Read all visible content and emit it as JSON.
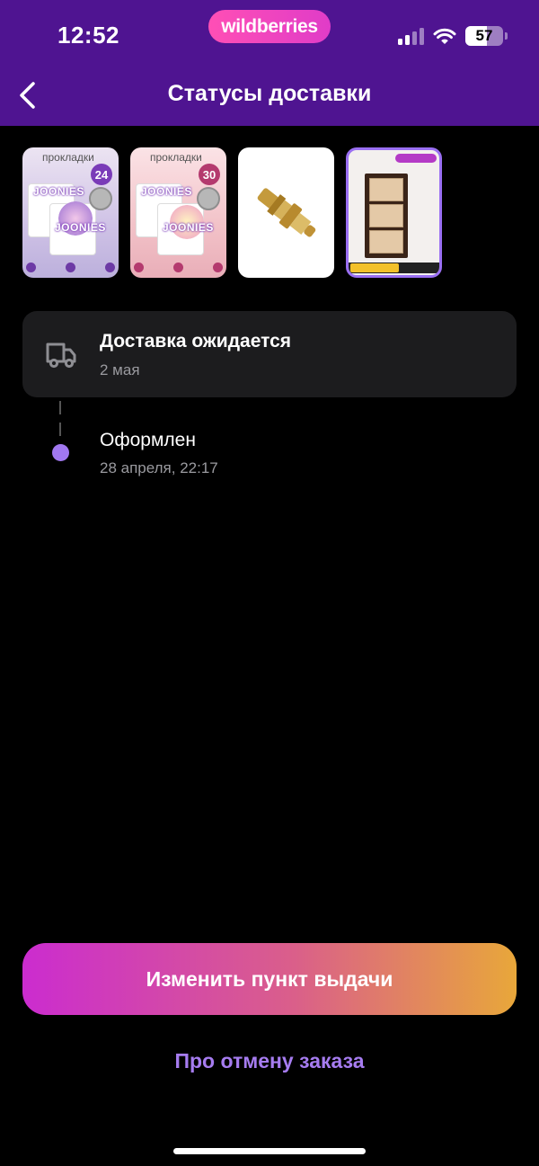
{
  "status_bar": {
    "time": "12:52",
    "brand": "wildberries",
    "battery": "57",
    "battery_level": 0.57,
    "icons": [
      "signal-icon",
      "wifi-icon",
      "battery-icon"
    ]
  },
  "header": {
    "title": "Статусы доставки",
    "back_icon": "chevron-left-icon"
  },
  "products": [
    {
      "label": "прокладки",
      "brand": "JOONIES",
      "count": "24"
    },
    {
      "label": "прокладки",
      "brand": "JOONIES",
      "count": "30"
    },
    {
      "label": ""
    },
    {
      "label": ""
    }
  ],
  "delivery": {
    "status": "Доставка ожидается",
    "date": "2 мая",
    "icon": "truck-icon"
  },
  "timeline": [
    {
      "title": "Оформлен",
      "date": "28 апреля, 22:17"
    }
  ],
  "actions": {
    "primary": "Изменить пункт выдачи",
    "secondary": "Про отмену заказа"
  },
  "colors": {
    "header_bg": "#4f1491",
    "accent": "#a178f0",
    "card_bg": "#1c1c1e",
    "button_gradient": [
      "#cb2ccf",
      "#da5f8a",
      "#e8a73a"
    ]
  }
}
